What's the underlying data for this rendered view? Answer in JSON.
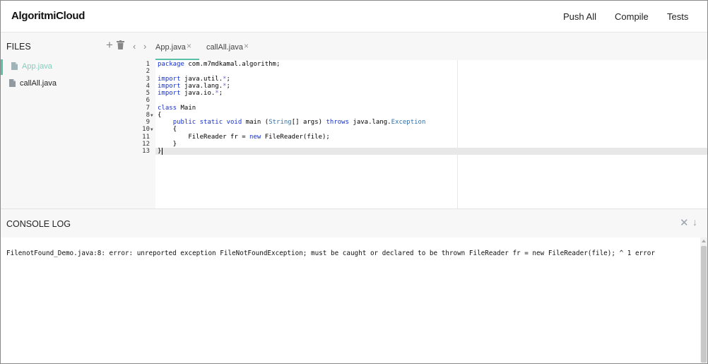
{
  "header": {
    "brand": "AlgoritmiCloud",
    "nav": [
      "Push All",
      "Compile",
      "Tests"
    ]
  },
  "sidebar": {
    "title": "FILES",
    "add_icon": "plus-icon",
    "delete_icon": "trash-icon",
    "files": [
      {
        "name": "App.java",
        "active": true
      },
      {
        "name": "callAll.java",
        "active": false
      }
    ]
  },
  "tabs": {
    "prev_icon": "chevron-left-icon",
    "next_icon": "chevron-right-icon",
    "items": [
      {
        "label": "App.java",
        "close": "×",
        "active": true
      },
      {
        "label": "callAll.java",
        "close": "×",
        "active": false
      }
    ]
  },
  "editor": {
    "line_numbers": [
      "1",
      "2",
      "3",
      "4",
      "5",
      "6",
      "7",
      "8",
      "9",
      "10",
      "11",
      "12",
      "13"
    ],
    "active_line": 13,
    "folded_lines": [
      8,
      10
    ],
    "lines": [
      "package com.m7mdkamal.algorithm;",
      "",
      "import java.util.*;",
      "import java.lang.*;",
      "import java.io.*;",
      "",
      "class Main",
      "{",
      "    public static void main (String[] args) throws java.lang.Exception",
      "    {",
      "        FileReader fr = new FileReader(file);",
      "    }",
      "}"
    ]
  },
  "console": {
    "title": "CONSOLE LOG",
    "close_icon": "close-icon",
    "scroll_down_icon": "arrow-down-icon",
    "message": "FilenotFound_Demo.java:8: error: unreported exception FileNotFoundException; must be caught or declared to be thrown FileReader fr = new FileReader(file); ^ 1 error"
  },
  "colors": {
    "accent": "#5bc0a8",
    "active_file_text": "#82cdbd",
    "panel_bg": "#f7f7f7",
    "keyword": "#1530c8",
    "type": "#2f6fa8"
  }
}
